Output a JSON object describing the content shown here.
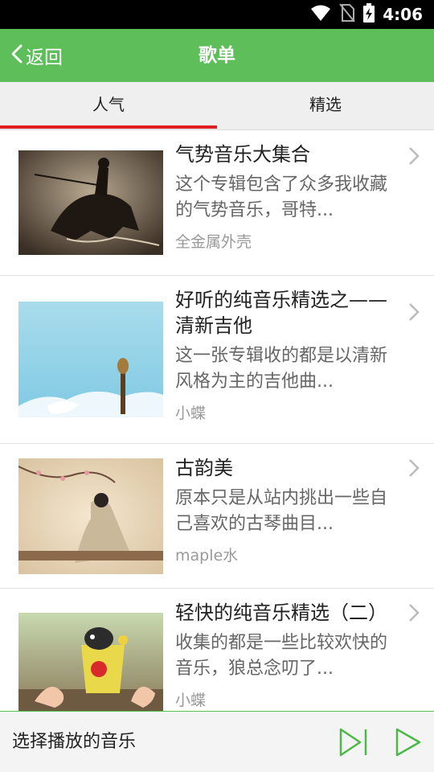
{
  "status_bar": {
    "time": "4:06"
  },
  "header": {
    "back_label": "返回",
    "title": "歌单"
  },
  "tabs": [
    {
      "label": "人气",
      "selected": true
    },
    {
      "label": "精选",
      "selected": false
    }
  ],
  "playlists": [
    {
      "title": "气势音乐大集合",
      "description": "这个专辑包含了众多我收藏的气势音乐，哥特...",
      "author": "全金属外壳",
      "thumbnail": "mount-blade-knight"
    },
    {
      "title": "好听的纯音乐精选之——清新吉他",
      "description": "这一张专辑收的都是以清新风格为主的吉他曲...",
      "author": "小蝶",
      "thumbnail": "guitar-blue-sky"
    },
    {
      "title": "古韵美",
      "description": "原本只是从站内挑出一些自己喜欢的古琴曲目...",
      "author": "maple水",
      "thumbnail": "ancient-lady-painting"
    },
    {
      "title": "轻快的纯音乐精选（二）",
      "description": "收集的都是一些比较欢快的音乐，狼总念叨了...",
      "author": "小蝶",
      "thumbnail": "kitten-in-cup"
    }
  ],
  "player": {
    "label": "选择播放的音乐"
  },
  "colors": {
    "accent": "#5dbe5a",
    "tab_indicator": "#e02020"
  }
}
